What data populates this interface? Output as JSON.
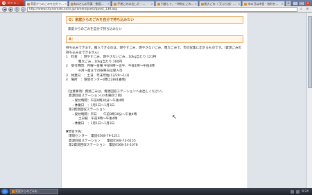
{
  "browser": {
    "menu_label": "メニュー",
    "tabs": [
      {
        "label": "家庭からのごみを自分で…",
        "active": true
      },
      {
        "label": "kyuさんの写真・動画…",
        "active": false
      },
      {
        "label": "不燃ごみの出し方 - …",
        "active": false
      },
      {
        "label": "引越して、一時的にごみ…",
        "active": false
      },
      {
        "label": "粗大ごみ（ 天ぷら油）…",
        "active": false
      },
      {
        "label": "市の日は市役・各町を…",
        "active": false
      }
    ],
    "address": "http://www.city.komaki.aichi.jp/ramen/quest/quest_138.asp"
  },
  "content": {
    "question": "Q：家庭からのごみを自分で持ち込みたい",
    "question_sub": "家庭からのごみを自分で持ち込みたい",
    "answer_label": "A：",
    "lines": [
      {
        "text": "持ち込みできます。搬入できるのは、燃やすごみ、燃やさないごみ、粗大ごみで、市の収集に出せるものです。(資源ごみの持ち込みはできません)",
        "indent": 0
      },
      {
        "text": "1　料金　：燃やすごみ、燃やさないごみ…10kg当たり 121円",
        "indent": 0
      },
      {
        "text": "粗大ごみ…10kg当たり 160円",
        "indent": 3
      },
      {
        "text": "2　受付時間：月曜～金曜 午前9時～正午、午後1時～午後4時",
        "indent": 0
      },
      {
        "text": "※月～金までの祝祭日は受入可",
        "indent": 3
      },
      {
        "text": "3　休業日　：土日、年末年始(12/29～1/3)",
        "indent": 0
      },
      {
        "text": "4　場所　：環境センター(野口2881番地)",
        "indent": 0
      },
      {
        "text": "",
        "indent": -1
      },
      {
        "text": "",
        "indent": -1
      },
      {
        "text": "〈注意事項〉資源ごみは、資源回収ステーションへお出しください。",
        "indent": 0
      },
      {
        "text": "資源回収ステーション(小木東四丁目)",
        "indent": 1
      },
      {
        "text": "・受付時間：午前9時30分～午後4時",
        "indent": 2
      },
      {
        "text": "・休業日　：1月1日～1月3日",
        "indent": 2
      },
      {
        "text": "第2資源回収ステーション",
        "indent": 1
      },
      {
        "text": "・受付時間：平日　　午前9時30分～午後4時",
        "indent": 2
      },
      {
        "text": "土日祝　午前9時～午後4時",
        "indent": 3
      },
      {
        "text": "・休業日　：1月1日～1月3日",
        "indent": 2
      },
      {
        "text": "",
        "indent": -1
      },
      {
        "text": "▼問合せ先：",
        "indent": 0
      },
      {
        "text": "環境センター　電話0568-79-1211",
        "indent": 1
      },
      {
        "text": "資源回収ステーション　　電話0568-73-6155",
        "indent": 1
      },
      {
        "text": "第2資源回収ステーション　電話0568-54-1078",
        "indent": 1
      }
    ]
  },
  "taskbar": {
    "item_label": "家庭からのごみを…",
    "clock": "9:24"
  }
}
